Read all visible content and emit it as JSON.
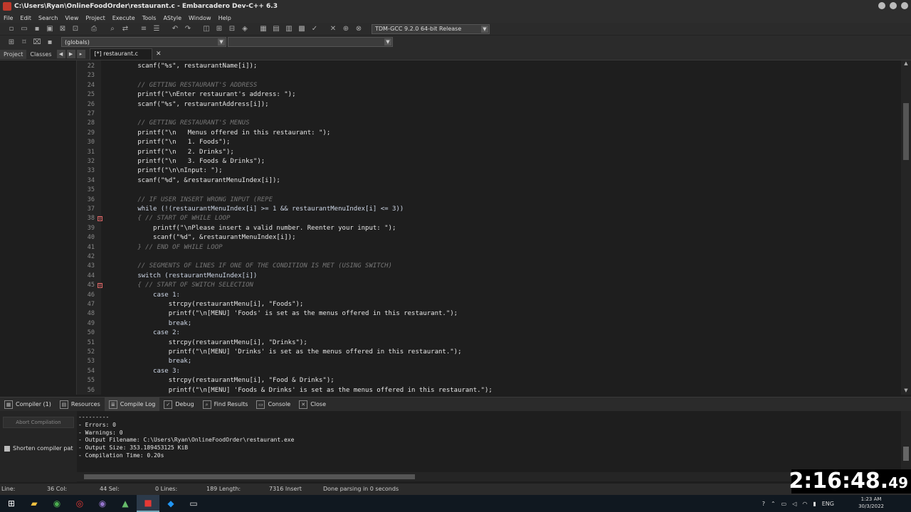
{
  "window": {
    "title": "C:\\Users\\Ryan\\OnlineFoodOrder\\restaurant.c - Embarcadero Dev-C++ 6.3"
  },
  "menubar": [
    "File",
    "Edit",
    "Search",
    "View",
    "Project",
    "Execute",
    "Tools",
    "AStyle",
    "Window",
    "Help"
  ],
  "toolbar": {
    "compiler_select": "TDM-GCC 9.2.0 64-bit Release",
    "class_select": "(globals)",
    "member_select": ""
  },
  "panel_tabs": [
    "Project",
    "Classes"
  ],
  "editor_tab": {
    "label": "[*] restaurant.c",
    "close": "✕"
  },
  "code_lines": [
    {
      "n": "22",
      "text": "        scanf(\"%s\", restaurantName[i]);",
      "type": "code"
    },
    {
      "n": "23",
      "text": "",
      "type": "code"
    },
    {
      "n": "24",
      "text": "        // GETTING RESTAURANT'S ADDRESS",
      "type": "comment"
    },
    {
      "n": "25",
      "text": "        printf(\"\\nEnter restaurant's address: \");",
      "type": "code"
    },
    {
      "n": "26",
      "text": "        scanf(\"%s\", restaurantAddress[i]);",
      "type": "code"
    },
    {
      "n": "27",
      "text": "",
      "type": "code"
    },
    {
      "n": "28",
      "text": "        // GETTING RESTAURANT'S MENUS",
      "type": "comment"
    },
    {
      "n": "29",
      "text": "        printf(\"\\n   Menus offered in this restaurant: \");",
      "type": "code"
    },
    {
      "n": "30",
      "text": "        printf(\"\\n   1. Foods\");",
      "type": "code"
    },
    {
      "n": "31",
      "text": "        printf(\"\\n   2. Drinks\");",
      "type": "code"
    },
    {
      "n": "32",
      "text": "        printf(\"\\n   3. Foods & Drinks\");",
      "type": "code"
    },
    {
      "n": "33",
      "text": "        printf(\"\\n\\nInput: \");",
      "type": "code"
    },
    {
      "n": "34",
      "text": "        scanf(\"%d\", &restaurantMenuIndex[i]);",
      "type": "code"
    },
    {
      "n": "35",
      "text": "",
      "type": "code"
    },
    {
      "n": "36",
      "text": "        // IF USER INSERT WRONG INPUT (REPE",
      "type": "comment"
    },
    {
      "n": "37",
      "text": "        while (!(restaurantMenuIndex[i] >= 1 && restaurantMenuIndex[i] <= 3))",
      "type": "kw"
    },
    {
      "n": "38",
      "text": "        { // START OF WHILE LOOP",
      "type": "comment",
      "fold": "⊟"
    },
    {
      "n": "39",
      "text": "            printf(\"\\nPlease insert a valid number. Reenter your input: \");",
      "type": "code"
    },
    {
      "n": "40",
      "text": "            scanf(\"%d\", &restaurantMenuIndex[i]);",
      "type": "code"
    },
    {
      "n": "41",
      "text": "        } // END OF WHILE LOOP",
      "type": "comment"
    },
    {
      "n": "42",
      "text": "",
      "type": "code"
    },
    {
      "n": "43",
      "text": "        // SEGMENTS OF LINES IF ONE OF THE CONDITION IS MET (USING SWITCH)",
      "type": "comment"
    },
    {
      "n": "44",
      "text": "        switch (restaurantMenuIndex[i])",
      "type": "kw"
    },
    {
      "n": "45",
      "text": "        { // START OF SWITCH SELECTION",
      "type": "comment",
      "fold": "⊟"
    },
    {
      "n": "46",
      "text": "            case 1:",
      "type": "kw"
    },
    {
      "n": "47",
      "text": "                strcpy(restaurantMenu[i], \"Foods\");",
      "type": "code"
    },
    {
      "n": "48",
      "text": "                printf(\"\\n[MENU] 'Foods' is set as the menus offered in this restaurant.\");",
      "type": "code"
    },
    {
      "n": "49",
      "text": "                break;",
      "type": "kw"
    },
    {
      "n": "50",
      "text": "            case 2:",
      "type": "kw"
    },
    {
      "n": "51",
      "text": "                strcpy(restaurantMenu[i], \"Drinks\");",
      "type": "code"
    },
    {
      "n": "52",
      "text": "                printf(\"\\n[MENU] 'Drinks' is set as the menus offered in this restaurant.\");",
      "type": "code"
    },
    {
      "n": "53",
      "text": "                break;",
      "type": "kw"
    },
    {
      "n": "54",
      "text": "            case 3:",
      "type": "kw"
    },
    {
      "n": "55",
      "text": "                strcpy(restaurantMenu[i], \"Food & Drinks\");",
      "type": "code"
    },
    {
      "n": "56",
      "text": "                printf(\"\\n[MENU] 'Foods & Drinks' is set as the menus offered in this restaurant.\");",
      "type": "code"
    }
  ],
  "bottom_tabs": [
    "Compiler (1)",
    "Resources",
    "Compile Log",
    "Debug",
    "Find Results",
    "Console",
    "Close"
  ],
  "bottom_left": {
    "abort_label": "Abort Compilation",
    "shorten_label": "Shorten compiler pat"
  },
  "compile_log": [
    "---------",
    "- Errors: 0",
    "- Warnings: 0",
    "- Output Filename: C:\\Users\\Ryan\\OnlineFoodOrder\\restaurant.exe",
    "- Output Size: 353.189453125 KiB",
    "- Compilation Time: 0.20s"
  ],
  "statusbar": {
    "line_label": "Line:",
    "col_label": "36 Col:",
    "sel_label": "44 Sel:",
    "lines_label": "0 Lines:",
    "length_label": "189 Length:",
    "mode_label": "7316 Insert",
    "parse_label": "Done parsing in 0 seconds"
  },
  "tray": {
    "lang": "ENG",
    "time": "1:23 AM",
    "date": "30/3/2022"
  },
  "timer": {
    "main": "2:16:48.",
    "ms": "49"
  }
}
